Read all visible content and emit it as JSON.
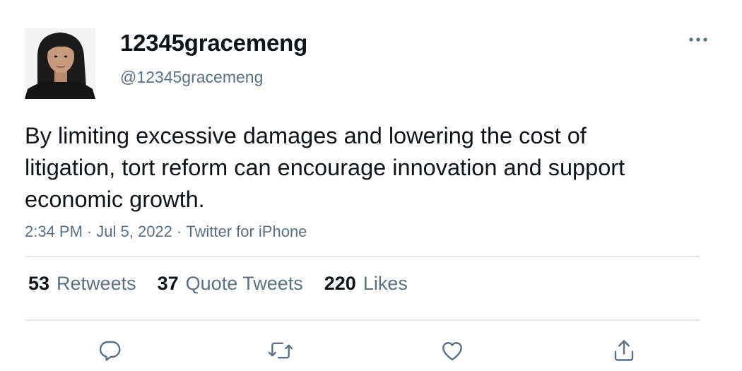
{
  "user": {
    "display_name": "12345gracemeng",
    "handle": "@12345gracemeng"
  },
  "tweet": {
    "text": "By limiting excessive damages and lowering the cost of litigation, tort reform can encourage innovation and support economic growth."
  },
  "meta": {
    "time": "2:34 PM",
    "date": "Jul 5, 2022",
    "source": "Twitter for iPhone",
    "separator": "·"
  },
  "stats": {
    "retweets_count": "53",
    "retweets_label": "Retweets",
    "quotes_count": "37",
    "quotes_label": "Quote Tweets",
    "likes_count": "220",
    "likes_label": "Likes"
  },
  "icons": {
    "more": "more-horizontal-icon",
    "reply": "reply-icon",
    "retweet": "retweet-icon",
    "like": "heart-icon",
    "share": "share-icon"
  },
  "colors": {
    "text": "#0f1419",
    "secondary": "#5b7083",
    "divider": "#e1e8ed"
  }
}
